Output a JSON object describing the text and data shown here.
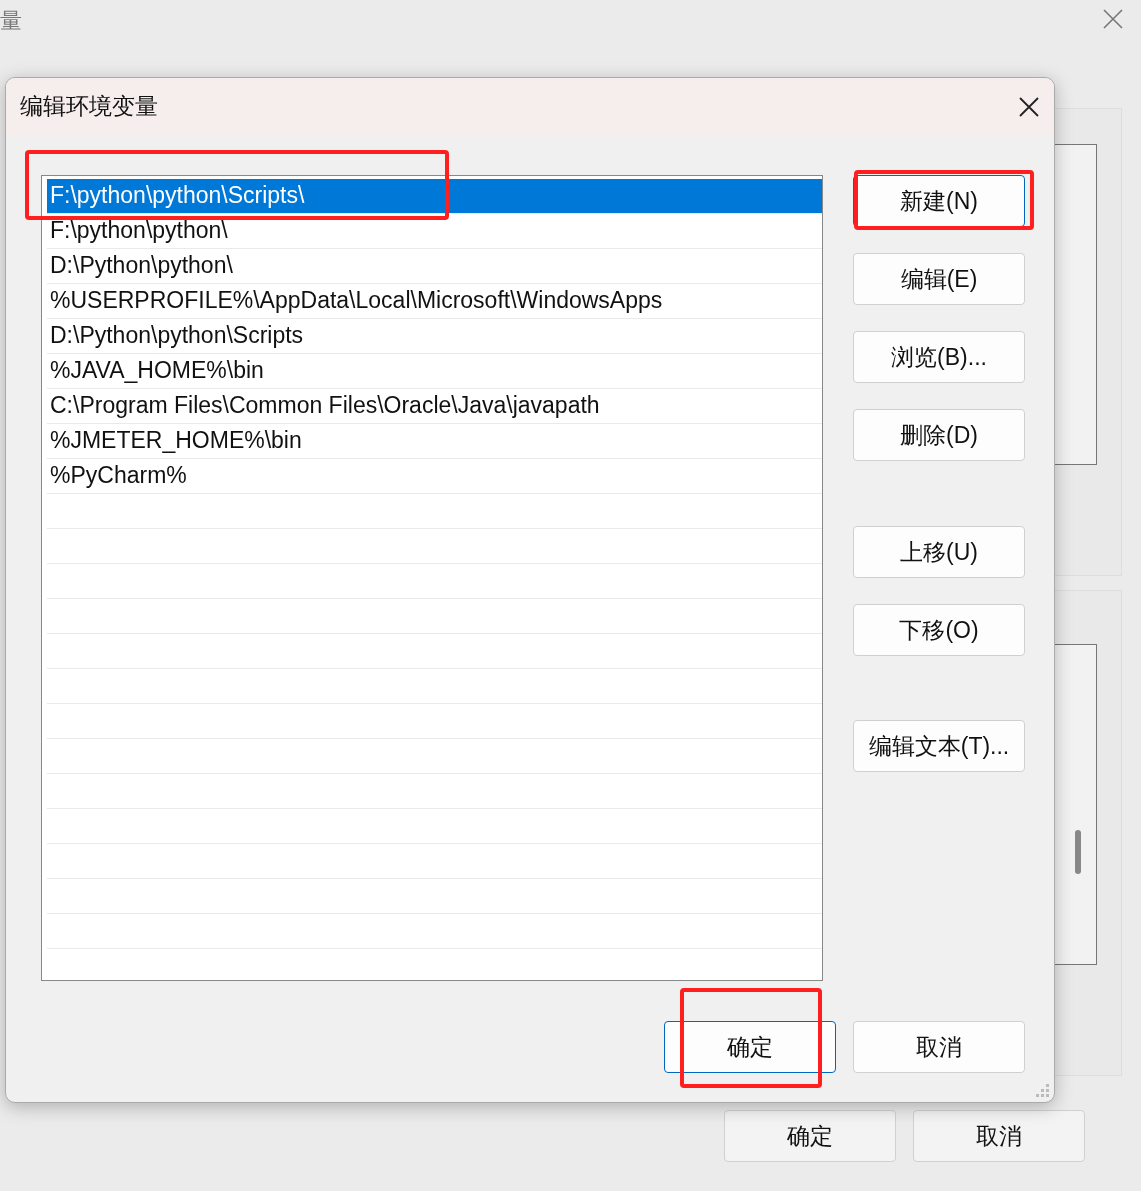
{
  "background_window": {
    "title": "量",
    "buttons": [
      {
        "label": "确定"
      },
      {
        "label": "取消"
      }
    ]
  },
  "dialog": {
    "title": "编辑环境变量",
    "entries": [
      {
        "text": "F:\\python\\python\\Scripts\\",
        "selected": true,
        "highlighted": true
      },
      {
        "text": "F:\\python\\python\\",
        "selected": false,
        "highlighted": false
      },
      {
        "text": "D:\\Python\\python\\",
        "selected": false,
        "highlighted": false
      },
      {
        "text": "%USERPROFILE%\\AppData\\Local\\Microsoft\\WindowsApps",
        "selected": false,
        "highlighted": false
      },
      {
        "text": "D:\\Python\\python\\Scripts",
        "selected": false,
        "highlighted": false
      },
      {
        "text": "%JAVA_HOME%\\bin",
        "selected": false,
        "highlighted": false
      },
      {
        "text": "C:\\Program Files\\Common Files\\Oracle\\Java\\javapath",
        "selected": false,
        "highlighted": false
      },
      {
        "text": "%JMETER_HOME%\\bin",
        "selected": false,
        "highlighted": false
      },
      {
        "text": "%PyCharm%",
        "selected": false,
        "highlighted": false
      }
    ],
    "button_groups": [
      [
        {
          "label": "新建(N)",
          "default": true,
          "highlighted": true
        },
        {
          "label": "编辑(E)",
          "default": false,
          "highlighted": false
        },
        {
          "label": "浏览(B)...",
          "default": false,
          "highlighted": false
        },
        {
          "label": "删除(D)",
          "default": false,
          "highlighted": false
        }
      ],
      [
        {
          "label": "上移(U)",
          "default": false,
          "highlighted": false
        },
        {
          "label": "下移(O)",
          "default": false,
          "highlighted": false
        }
      ],
      [
        {
          "label": "编辑文本(T)...",
          "default": false,
          "highlighted": false
        }
      ]
    ],
    "footer_buttons": [
      {
        "label": "确定",
        "default": true,
        "highlighted": true
      },
      {
        "label": "取消",
        "default": false,
        "highlighted": false
      }
    ]
  }
}
